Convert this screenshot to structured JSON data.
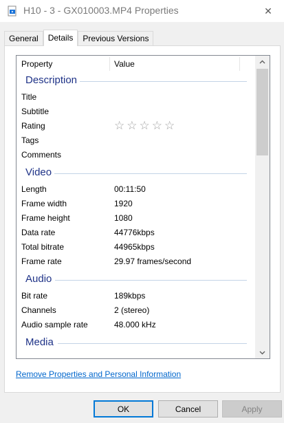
{
  "window": {
    "title": "H10 - 3 - GX010003.MP4 Properties",
    "close_glyph": "✕",
    "app_icon": "video-file-icon"
  },
  "tabs": [
    {
      "label": "General",
      "active": false
    },
    {
      "label": "Details",
      "active": true
    },
    {
      "label": "Previous Versions",
      "active": false
    }
  ],
  "list": {
    "col_property": "Property",
    "col_value": "Value",
    "groups": {
      "description": {
        "title": "Description",
        "rows": [
          {
            "name": "Title",
            "value": ""
          },
          {
            "name": "Subtitle",
            "value": ""
          },
          {
            "name": "Rating",
            "value": ""
          },
          {
            "name": "Tags",
            "value": ""
          },
          {
            "name": "Comments",
            "value": ""
          }
        ],
        "rating_stars": 0,
        "rating_max": 5
      },
      "video": {
        "title": "Video",
        "rows": [
          {
            "name": "Length",
            "value": "00:11:50"
          },
          {
            "name": "Frame width",
            "value": "1920"
          },
          {
            "name": "Frame height",
            "value": "1080"
          },
          {
            "name": "Data rate",
            "value": "44776kbps"
          },
          {
            "name": "Total bitrate",
            "value": "44965kbps"
          },
          {
            "name": "Frame rate",
            "value": "29.97 frames/second"
          }
        ]
      },
      "audio": {
        "title": "Audio",
        "rows": [
          {
            "name": "Bit rate",
            "value": "189kbps"
          },
          {
            "name": "Channels",
            "value": "2 (stereo)"
          },
          {
            "name": "Audio sample rate",
            "value": "48.000 kHz"
          }
        ]
      },
      "media": {
        "title": "Media"
      }
    }
  },
  "remove_link": "Remove Properties and Personal Information",
  "buttons": {
    "ok": "OK",
    "cancel": "Cancel",
    "apply": "Apply"
  },
  "colors": {
    "group_title": "#1e3287",
    "link": "#0066cc",
    "default_button_border": "#0078d7"
  }
}
